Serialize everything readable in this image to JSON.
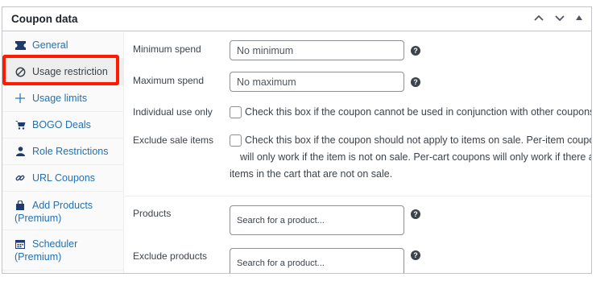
{
  "panel": {
    "title": "Coupon data"
  },
  "sidebar": {
    "items": [
      {
        "label": "General",
        "icon": "ticket-icon"
      },
      {
        "label": "Usage restriction",
        "icon": "block-icon"
      },
      {
        "label": "Usage limits",
        "icon": "plus-crosshair-icon"
      },
      {
        "label": "BOGO Deals",
        "icon": "cart-icon"
      },
      {
        "label": "Role Restrictions",
        "icon": "user-icon"
      },
      {
        "label": "URL Coupons",
        "icon": "link-icon"
      },
      {
        "label": "Add Products",
        "label2": "(Premium)",
        "icon": "bag-icon"
      },
      {
        "label": "Scheduler",
        "label2": "(Premium)",
        "icon": "calendar-icon"
      }
    ]
  },
  "fields": {
    "minimum_spend": {
      "label": "Minimum spend",
      "placeholder": "No minimum"
    },
    "maximum_spend": {
      "label": "Maximum spend",
      "placeholder": "No maximum"
    },
    "individual_use": {
      "label": "Individual use only",
      "description": "Check this box if the coupon cannot be used in conjunction with other coupons."
    },
    "exclude_sale": {
      "label": "Exclude sale items",
      "line1": "Check this box if the coupon should not apply to items on sale. Per-item coupons",
      "line2": "will only work if the item is not on sale. Per-cart coupons will only work if there are",
      "line3": "items in the cart that are not on sale."
    },
    "products": {
      "label": "Products",
      "placeholder": "Search for a product..."
    },
    "exclude_products": {
      "label": "Exclude products",
      "placeholder": "Search for a product..."
    }
  },
  "help_glyph": "?",
  "colors": {
    "link": "#2271b1",
    "highlight": "#ff1a00",
    "active_bg": "#eeeeee"
  }
}
